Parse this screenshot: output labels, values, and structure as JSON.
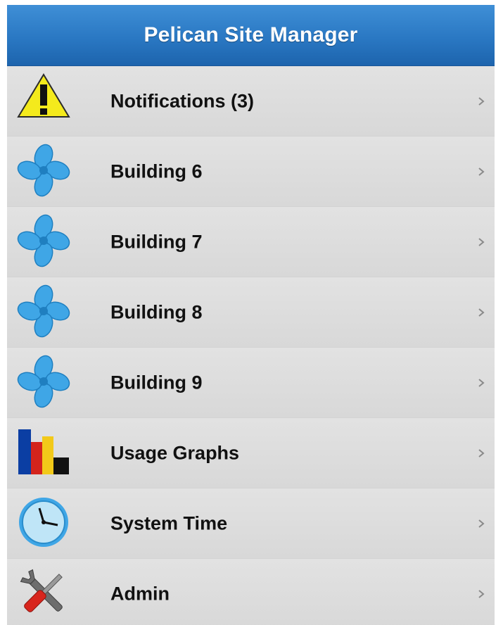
{
  "header": {
    "title": "Pelican Site Manager"
  },
  "colors": {
    "header_blue": "#2a78c3",
    "list_background": "#dcdcdc",
    "fan_blue": "#3fa6e6",
    "warning_yellow": "#f4ea1c",
    "graph_blue": "#0b3ea3",
    "graph_red": "#d4241c",
    "graph_yellow": "#f2c919",
    "clock_face": "#bfe5f7"
  },
  "menu": {
    "items": [
      {
        "label": "Notifications (3)",
        "icon": "warning-icon"
      },
      {
        "label": "Building 6",
        "icon": "fan-icon"
      },
      {
        "label": "Building 7",
        "icon": "fan-icon"
      },
      {
        "label": "Building 8",
        "icon": "fan-icon"
      },
      {
        "label": "Building 9",
        "icon": "fan-icon"
      },
      {
        "label": "Usage Graphs",
        "icon": "bar-graph-icon"
      },
      {
        "label": "System Time",
        "icon": "clock-icon"
      },
      {
        "label": "Admin",
        "icon": "wrench-screwdriver-icon"
      }
    ]
  }
}
